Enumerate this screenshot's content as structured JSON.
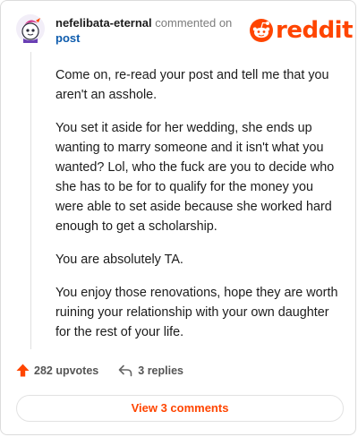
{
  "header": {
    "username": "nefelibata-eternal",
    "commented_text": "commented on",
    "post_link": "post",
    "logo_text": "reddit"
  },
  "comment": {
    "paragraphs": [
      "Come on, re-read your post and tell me that you aren't an asshole.",
      "You set it aside for her wedding, she ends up wanting to marry someone and it isn't what you wanted? Lol, who the fuck are you to decide who she has to be for to qualify for the money you were able to set aside because she worked hard enough to get a scholarship.",
      "You are absolutely TA.",
      "You enjoy those renovations, hope they are worth ruining your relationship with your own daughter for the rest of your life."
    ]
  },
  "footer": {
    "upvotes": "282 upvotes",
    "replies": "3 replies",
    "view_comments": "View 3 comments"
  },
  "colors": {
    "brand": "#ff4500",
    "link": "#0e5cad"
  },
  "icons": {
    "avatar": "snoo-avatar",
    "logo": "reddit-snoo-icon",
    "upvote": "upvote-arrow-icon",
    "reply": "reply-arrow-icon"
  }
}
